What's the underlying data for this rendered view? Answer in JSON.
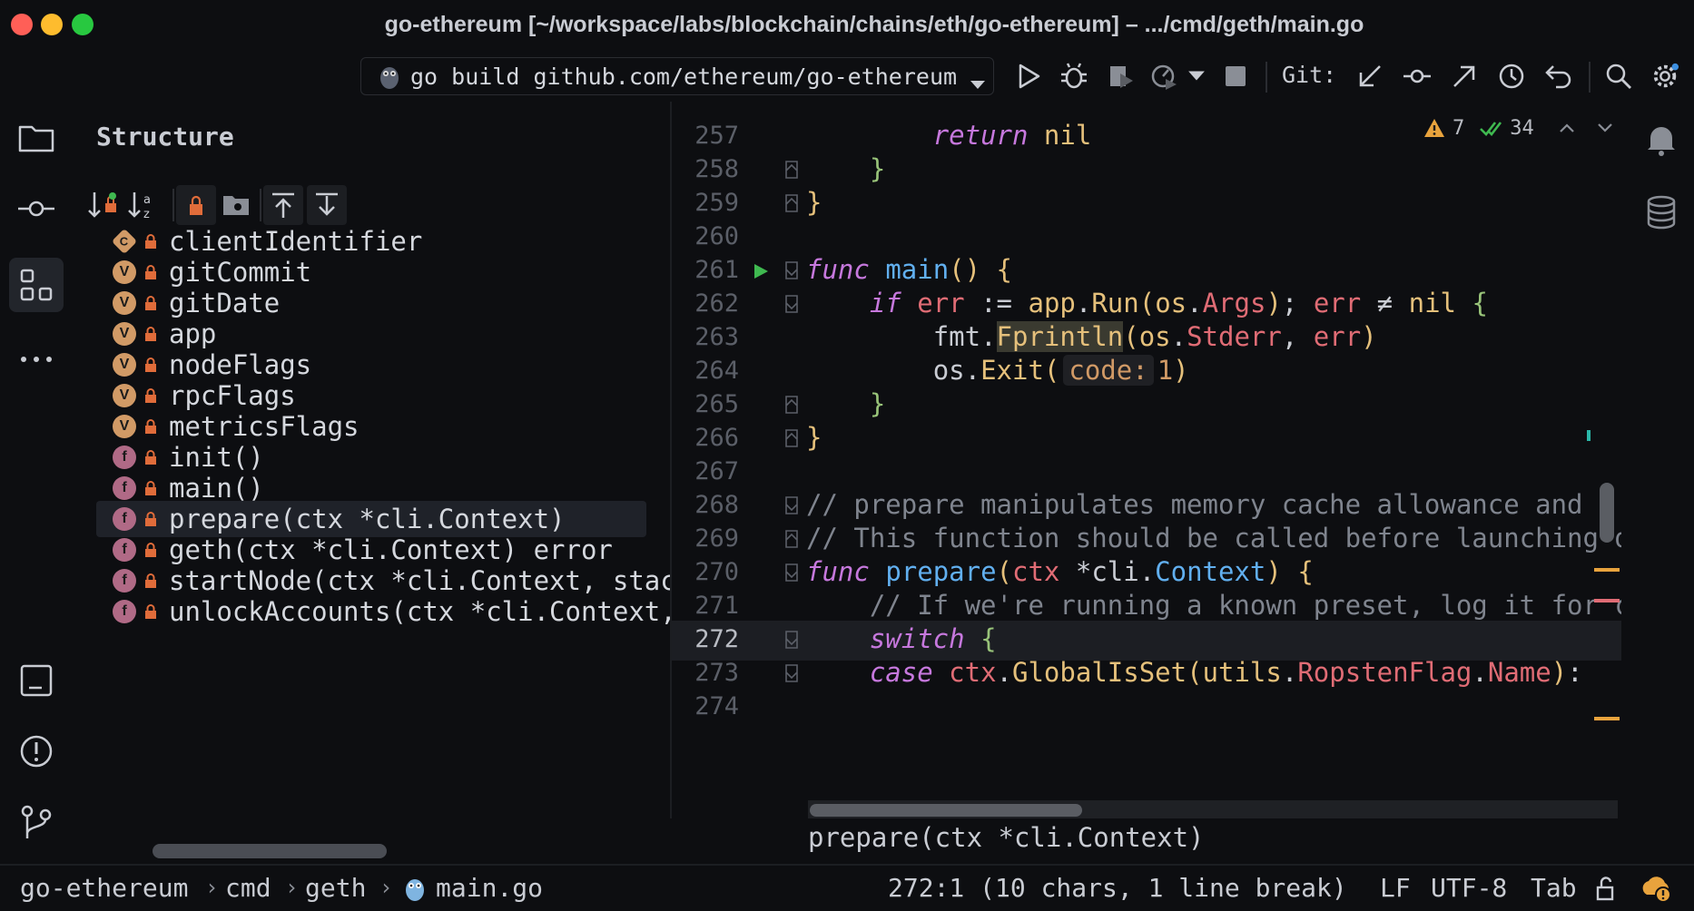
{
  "window": {
    "title": "go-ethereum [~/workspace/labs/blockchain/chains/eth/go-ethereum] – .../cmd/geth/main.go"
  },
  "toolbar": {
    "run_config": "go build github.com/ethereum/go-ethereum",
    "git_label": "Git:"
  },
  "structure": {
    "title": "Structure",
    "items": [
      {
        "kind": "C",
        "label": "clientIdentifier"
      },
      {
        "kind": "V",
        "label": "gitCommit"
      },
      {
        "kind": "V",
        "label": "gitDate"
      },
      {
        "kind": "V",
        "label": "app"
      },
      {
        "kind": "V",
        "label": "nodeFlags"
      },
      {
        "kind": "V",
        "label": "rpcFlags"
      },
      {
        "kind": "V",
        "label": "metricsFlags"
      },
      {
        "kind": "f",
        "label": "init()"
      },
      {
        "kind": "f",
        "label": "main()"
      },
      {
        "kind": "f",
        "label": "prepare(ctx *cli.Context)",
        "selected": true
      },
      {
        "kind": "f",
        "label": "geth(ctx *cli.Context) error"
      },
      {
        "kind": "f",
        "label": "startNode(ctx *cli.Context, stac"
      },
      {
        "kind": "f",
        "label": "unlockAccounts(ctx *cli.Context,"
      }
    ]
  },
  "editor": {
    "inspections": {
      "warnings": "7",
      "ok": "34"
    },
    "line_numbers": [
      "257",
      "258",
      "259",
      "260",
      "261",
      "262",
      "263",
      "264",
      "265",
      "266",
      "267",
      "268",
      "269",
      "270",
      "271",
      "272",
      "273",
      "274"
    ],
    "current_line": "272",
    "tokens": {
      "return": "return",
      "nil": "nil",
      "brace_close": "}",
      "func": "func",
      "main": "main",
      "paren_open_close": "()",
      "brace_open": "{",
      "if": "if",
      "err": "err",
      "assign": ":=",
      "app": "app",
      "dot": ".",
      "run": "Run",
      "os": "os",
      "args": "Args",
      "semi": ";",
      "neq": "≠",
      "fmt": "fmt",
      "fprintln": "Fprintln",
      "stderr": "Stderr",
      "comma": ",",
      "exit": "Exit",
      "code_hint": "code:",
      "one": "1",
      "paren_open": "(",
      "paren_close": ")",
      "comment_268": "// prepare manipulates memory cache allowance and s",
      "comment_269": "// This function should be called before launching d",
      "prepare": "prepare",
      "ctx": "ctx",
      "star_cli": "*cli.",
      "context": "Context",
      "comment_271": "// If we're running a known preset, log it for c",
      "switch": "switch",
      "case": "case",
      "globalisset": "GlobalIsSet",
      "utils": "utils",
      "ropstenflag": "RopstenFlag",
      "name": "Name",
      "colon": ":",
      "partial_274": "274"
    },
    "sticky_function": "prepare(ctx *cli.Context)"
  },
  "statusbar": {
    "breadcrumbs": [
      "go-ethereum",
      "cmd",
      "geth",
      "main.go"
    ],
    "position": "272:1 (10 chars, 1 line break)",
    "line_ending": "LF",
    "encoding": "UTF-8",
    "indent": "Tab"
  },
  "colors": {
    "background": "#0d0e11",
    "keyword": "#c678dd",
    "function": "#61afef",
    "call": "#e5c07b",
    "identifier": "#e06c75",
    "run_green": "#3fb950"
  }
}
